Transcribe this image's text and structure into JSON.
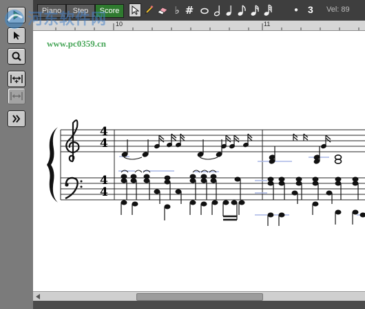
{
  "toolbar": {
    "tabs": [
      {
        "label": "Piano",
        "active": false
      },
      {
        "label": "Step",
        "active": false
      },
      {
        "label": "Score",
        "active": true
      }
    ],
    "tools": {
      "pointer": "pointer-icon",
      "pencil": "pencil-icon",
      "eraser": "eraser-icon",
      "flat": "♭",
      "sharp": "#",
      "dot": "•"
    },
    "tuplet": "3",
    "velocity": "Vel: 89"
  },
  "ruler": {
    "labels": [
      "10",
      "11"
    ]
  },
  "watermark": {
    "title": "河东软件网",
    "url": "www.pc0359.cn"
  },
  "colors": {
    "active_tab": "#2f7a2f",
    "toolbar_bg": "#3e3e3e",
    "panel_bg": "#7b7b7b",
    "score_bg": "#ffffff"
  },
  "score": {
    "treble_time_sig": [
      "4",
      "4"
    ],
    "bass_time_sig": [
      "4",
      "4"
    ]
  }
}
